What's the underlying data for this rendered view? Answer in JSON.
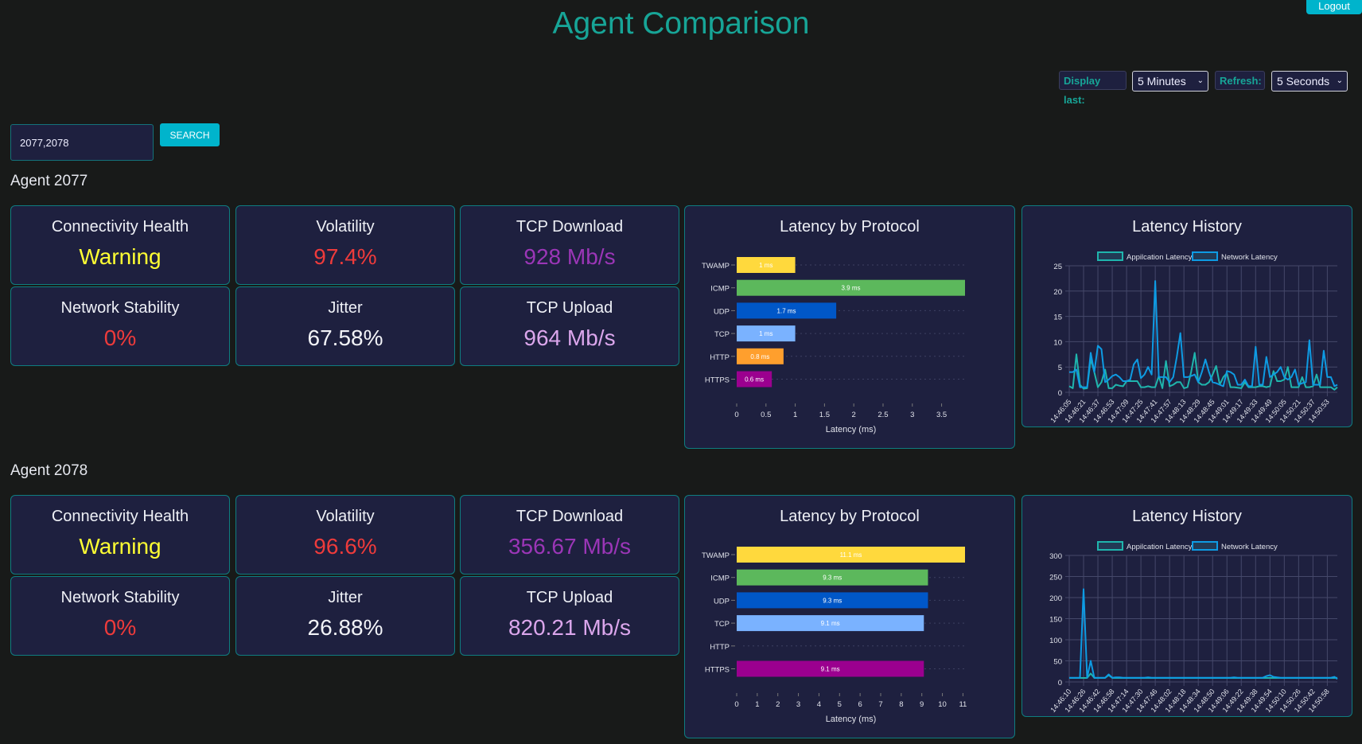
{
  "header": {
    "title": "Agent Comparison",
    "logout_label": "Logout"
  },
  "controls": {
    "display_last_label": "Display last:",
    "display_last_value": "5 Minutes",
    "refresh_label": "Refresh:",
    "refresh_value": "5 Seconds"
  },
  "search": {
    "value": "2077,2078",
    "button_label": "SEARCH"
  },
  "colors": {
    "accent": "#17a597",
    "button": "#00b4cc",
    "card_bg": "#1e203f",
    "card_border": "#0f7d80",
    "warning": "#ffff33",
    "bad": "#ee3b3b",
    "download": "#9b36b7",
    "upload": "#dba6ec",
    "neutral": "#f2f3f7"
  },
  "agents": [
    {
      "heading": "Agent 2077",
      "stats": [
        {
          "label": "Connectivity Health",
          "value": "Warning",
          "color": "#ffff33"
        },
        {
          "label": "Volatility",
          "value": "97.4%",
          "color": "#ee3b3b"
        },
        {
          "label": "TCP Download",
          "value": "928 Mb/s",
          "color": "#9b36b7"
        },
        {
          "label": "Network Stability",
          "value": "0%",
          "color": "#ee3b3b"
        },
        {
          "label": "Jitter",
          "value": "67.58%",
          "color": "#f2f3f7"
        },
        {
          "label": "TCP Upload",
          "value": "964 Mb/s",
          "color": "#dba6ec"
        }
      ]
    },
    {
      "heading": "Agent 2078",
      "stats": [
        {
          "label": "Connectivity Health",
          "value": "Warning",
          "color": "#ffff33"
        },
        {
          "label": "Volatility",
          "value": "96.6%",
          "color": "#ee3b3b"
        },
        {
          "label": "TCP Download",
          "value": "356.67 Mb/s",
          "color": "#9b36b7"
        },
        {
          "label": "Network Stability",
          "value": "0%",
          "color": "#ee3b3b"
        },
        {
          "label": "Jitter",
          "value": "26.88%",
          "color": "#f2f3f7"
        },
        {
          "label": "TCP Upload",
          "value": "820.21 Mb/s",
          "color": "#dba6ec"
        }
      ]
    }
  ],
  "chart_data": [
    {
      "type": "bar",
      "orientation": "horizontal",
      "title": "Latency by Protocol",
      "categories": [
        "TWAMP",
        "ICMP",
        "UDP",
        "TCP",
        "HTTP",
        "HTTPS"
      ],
      "values": [
        1,
        3.9,
        1.7,
        1,
        0.8,
        0.6
      ],
      "data_labels": [
        "1 ms",
        "3.9 ms",
        "1.7 ms",
        "1 ms",
        "0.8 ms",
        "0.6 ms"
      ],
      "bar_colors": [
        "#ffd93d",
        "#5cb85c",
        "#0057c8",
        "#7ab2ff",
        "#ff9f2d",
        "#9b008f"
      ],
      "xlabel": "Latency (ms)",
      "xlim": [
        0,
        3.9
      ],
      "xticks": [
        "0",
        "0.5",
        "1",
        "1.5",
        "2",
        "2.5",
        "3",
        "3.5"
      ]
    },
    {
      "type": "line",
      "title": "Latency History",
      "legend": "top",
      "x_tick_labels": [
        "14:46:05",
        "14:46:21",
        "14:46:37",
        "14:46:53",
        "14:47:09",
        "14:47:25",
        "14:47:41",
        "14:47:57",
        "14:48:13",
        "14:48:29",
        "14:48:45",
        "14:49:01",
        "14:49:17",
        "14:49:33",
        "14:49:49",
        "14:50:05",
        "14:50:21",
        "14:50:37",
        "14:50:53"
      ],
      "ylim": [
        0,
        25
      ],
      "yticks": [
        "0",
        "5",
        "10",
        "15",
        "20",
        "25"
      ],
      "grid": true,
      "series": [
        {
          "name": "Appilcation Latency",
          "color": "#1fb5ad",
          "values": [
            1.2,
            0.8,
            7.5,
            1.5,
            0.7,
            0.8,
            6.6,
            4,
            1,
            2,
            4.5,
            0.8,
            0.8,
            1.5,
            1.3,
            1.2,
            2.2,
            2.2,
            2.2,
            2.2,
            1,
            1,
            1.2,
            1,
            1,
            3.2,
            0.8,
            6.2,
            1.2,
            1.5,
            2,
            2,
            0.8,
            1,
            4,
            7.8,
            2,
            1.5,
            1.5,
            2,
            3.5,
            5.2,
            1.5,
            3,
            3.8,
            1,
            1,
            0.9,
            0.8,
            2,
            1,
            1,
            1,
            1.2,
            1.2,
            1,
            1.2,
            4.2,
            2.2,
            2.2,
            2.5,
            5,
            1,
            1,
            1,
            3,
            1,
            1,
            1.2,
            3.5,
            1,
            1,
            1,
            1,
            0.5,
            1
          ]
        },
        {
          "name": "Network Latency",
          "color": "#0e9be3",
          "values": [
            4,
            4,
            4.5,
            1,
            1,
            1,
            7.8,
            4,
            9.2,
            8.5,
            2,
            2.5,
            3.2,
            3.5,
            3,
            2.2,
            2.2,
            2.5,
            5.5,
            6.5,
            2.8,
            3.5,
            5,
            3.5,
            22,
            3,
            3,
            3,
            2,
            3,
            7,
            11.7,
            3,
            3,
            3.2,
            3.5,
            2,
            4,
            6.5,
            4,
            2,
            1.8,
            1.5,
            1.2,
            4.2,
            4,
            3.5,
            1.5,
            1.5,
            2.5,
            1.2,
            1.2,
            9,
            1.5,
            1.5,
            7,
            3,
            3.5,
            4,
            5,
            3,
            2.5,
            3,
            4.5,
            1.5,
            1.8,
            2,
            10.3,
            1.5,
            1.5,
            1.5,
            8.2,
            3,
            3,
            1.2,
            1.5
          ]
        }
      ]
    },
    {
      "type": "bar",
      "orientation": "horizontal",
      "title": "Latency by Protocol",
      "categories": [
        "TWAMP",
        "ICMP",
        "UDP",
        "TCP",
        "HTTP",
        "HTTPS"
      ],
      "values": [
        11.1,
        9.3,
        9.3,
        9.1,
        null,
        9.1
      ],
      "data_labels": [
        "11.1 ms",
        "9.3 ms",
        "9.3 ms",
        "9.1 ms",
        "",
        "9.1 ms"
      ],
      "bar_colors": [
        "#ffd93d",
        "#5cb85c",
        "#0057c8",
        "#7ab2ff",
        "#ff9f2d",
        "#9b008f"
      ],
      "xlabel": "Latency (ms)",
      "xlim": [
        0,
        11.1
      ],
      "xticks": [
        "0",
        "1",
        "2",
        "3",
        "4",
        "5",
        "6",
        "7",
        "8",
        "9",
        "10",
        "11"
      ]
    },
    {
      "type": "line",
      "title": "Latency History",
      "legend": "top",
      "x_tick_labels": [
        "14:46:10",
        "14:46:26",
        "14:46:42",
        "14:46:58",
        "14:47:14",
        "14:47:30",
        "14:47:46",
        "14:48:02",
        "14:48:18",
        "14:48:34",
        "14:48:50",
        "14:49:06",
        "14:49:22",
        "14:49:38",
        "14:49:54",
        "14:50:10",
        "14:50:26",
        "14:50:42",
        "14:50:58"
      ],
      "ylim": [
        0,
        300
      ],
      "yticks": [
        "0",
        "50",
        "100",
        "150",
        "200",
        "250",
        "300"
      ],
      "grid": true,
      "series": [
        {
          "name": "Appilcation Latency",
          "color": "#1fb5ad",
          "values": [
            9.5,
            9.5,
            9.5,
            9.5,
            9.5,
            9.5,
            20,
            9.5,
            9.5,
            9.5,
            9.5,
            16,
            9.5,
            9.5,
            9.5,
            9.5,
            9.5,
            9.5,
            9.5,
            9.5,
            9.5,
            9.5,
            9.5,
            9.5,
            9.5,
            9.5,
            9.5,
            9.5,
            9.5,
            9.5,
            9.5,
            9.5,
            9.5,
            9.5,
            9.5,
            9.5,
            9.5,
            9.5,
            9.5,
            9.5,
            9.5,
            9.5,
            9.5,
            9.5,
            9.5,
            9.5,
            9.5,
            9.5,
            9.5,
            9.5,
            9.5,
            9.5,
            9.5,
            9.5,
            9.5,
            9.5,
            9.5,
            9.5,
            9.5,
            9.5,
            9.5,
            9.5,
            9.5,
            9.5,
            9.5,
            9.5,
            9.5,
            9.5,
            9.5,
            9.5,
            9.5,
            9.5,
            9.5,
            9.5,
            9.5,
            10
          ]
        },
        {
          "name": "Network Latency",
          "color": "#0e9be3",
          "values": [
            10,
            10,
            10,
            10,
            220,
            10,
            50,
            10,
            10,
            10,
            10,
            18,
            10,
            11,
            11,
            10,
            10,
            10,
            10,
            10,
            10,
            10,
            11,
            10,
            10,
            10,
            10,
            10,
            10,
            10,
            10,
            10,
            10,
            10,
            10,
            10,
            10,
            10,
            10,
            10,
            10,
            10,
            10,
            10,
            10,
            10,
            11,
            10,
            10,
            10,
            10,
            10,
            10,
            10,
            10,
            14,
            16,
            12,
            11,
            10,
            10,
            10,
            10,
            10,
            10,
            10,
            10,
            10,
            10,
            10,
            10,
            10,
            10,
            10,
            12,
            7
          ]
        }
      ]
    }
  ]
}
